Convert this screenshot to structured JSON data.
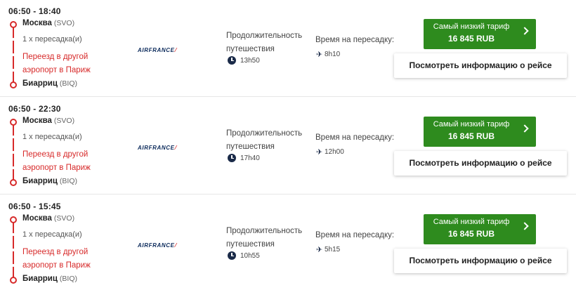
{
  "colors": {
    "accent_red": "#d72a2a",
    "price_green": "#2e8b1e",
    "navy": "#1a2a48"
  },
  "flights": [
    {
      "times": "06:50 - 18:40",
      "from_city": "Москва",
      "from_code": "(SVO)",
      "stops": "1 x пересадка(и)",
      "airport_change": "Переезд в другой аэропорт в Париж",
      "to_city": "Биарриц",
      "to_code": "(BIQ)",
      "airline": "AIRFRANCE",
      "duration_label": "Продолжительность путешествия",
      "duration": "13h50",
      "layover_label": "Время на пересадку:",
      "layover": "8h10",
      "price_label": "Самый низкий тариф",
      "price": "16 845 RUB",
      "info_button": "Посмотреть информацию о рейсе"
    },
    {
      "times": "06:50 - 22:30",
      "from_city": "Москва",
      "from_code": "(SVO)",
      "stops": "1 x пересадка(и)",
      "airport_change": "Переезд в другой аэропорт в Париж",
      "to_city": "Биарриц",
      "to_code": "(BIQ)",
      "airline": "AIRFRANCE",
      "duration_label": "Продолжительность путешествия",
      "duration": "17h40",
      "layover_label": "Время на пересадку:",
      "layover": "12h00",
      "price_label": "Самый низкий тариф",
      "price": "16 845 RUB",
      "info_button": "Посмотреть информацию о рейсе"
    },
    {
      "times": "06:50 - 15:45",
      "from_city": "Москва",
      "from_code": "(SVO)",
      "stops": "1 x пересадка(и)",
      "airport_change": "Переезд в другой аэропорт в Париж",
      "to_city": "Биарриц",
      "to_code": "(BIQ)",
      "airline": "AIRFRANCE",
      "duration_label": "Продолжительность путешествия",
      "duration": "10h55",
      "layover_label": "Время на пересадку:",
      "layover": "5h15",
      "price_label": "Самый низкий тариф",
      "price": "16 845 RUB",
      "info_button": "Посмотреть информацию о рейсе"
    }
  ]
}
